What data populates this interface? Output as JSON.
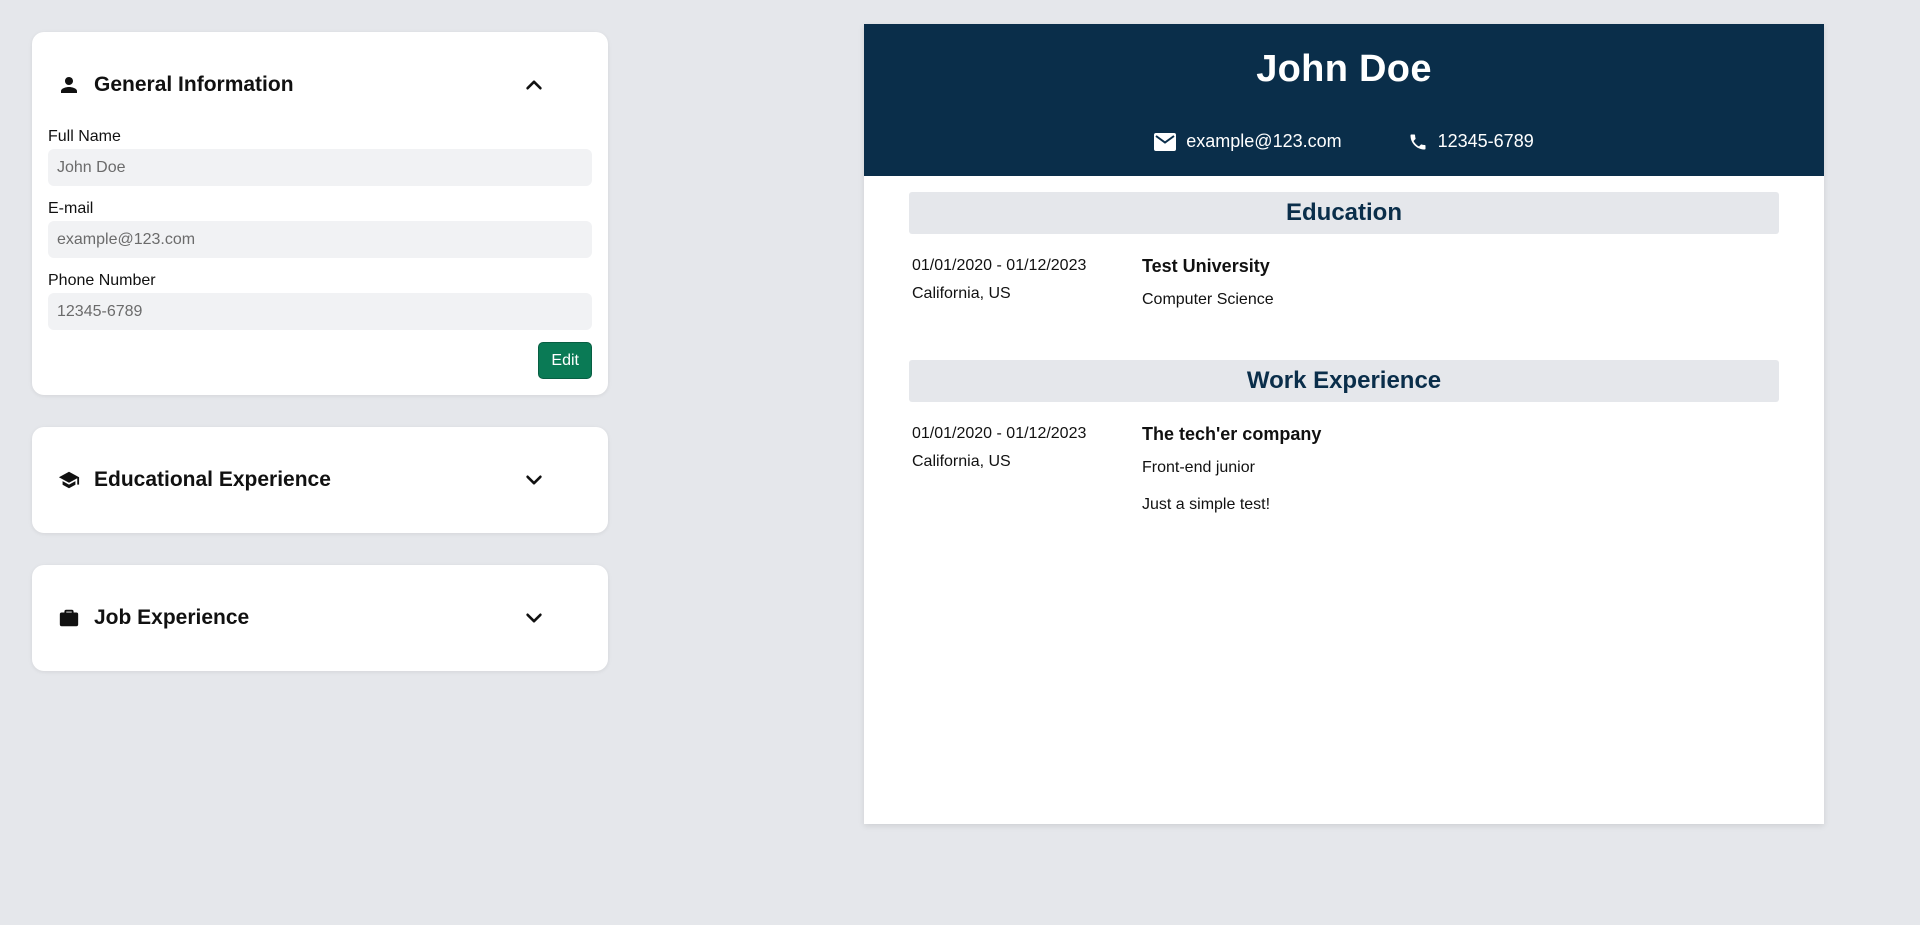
{
  "editor": {
    "general": {
      "title": "General Information",
      "fields": [
        {
          "label": "Full Name",
          "placeholder": "John Doe"
        },
        {
          "label": "E-mail",
          "placeholder": "example@123.com"
        },
        {
          "label": "Phone Number",
          "placeholder": "12345-6789"
        }
      ],
      "edit_label": "Edit"
    },
    "education": {
      "title": "Educational Experience"
    },
    "jobs": {
      "title": "Job Experience"
    }
  },
  "cv": {
    "name": "John Doe",
    "email": "example@123.com",
    "phone": "12345-6789",
    "education": {
      "title": "Education",
      "entries": [
        {
          "dates": "01/01/2020 - 01/12/2023",
          "location": "California, US",
          "school": "Test University",
          "study": "Computer Science"
        }
      ]
    },
    "work": {
      "title": "Work Experience",
      "entries": [
        {
          "dates": "01/01/2020 - 01/12/2023",
          "location": "California, US",
          "company": "The tech'er company",
          "position": "Front-end junior",
          "description": "Just a simple test!"
        }
      ]
    }
  },
  "colors": {
    "background": "#e5e7eb",
    "header": "#0a2e4a",
    "accent_button": "#0a7a55"
  },
  "icons": {
    "general": "person-icon",
    "education": "graduation-cap-icon",
    "jobs": "briefcase-icon",
    "expand_open": "chevron-up-icon",
    "expand_closed": "chevron-down-icon",
    "email": "mail-icon",
    "phone": "phone-icon"
  }
}
